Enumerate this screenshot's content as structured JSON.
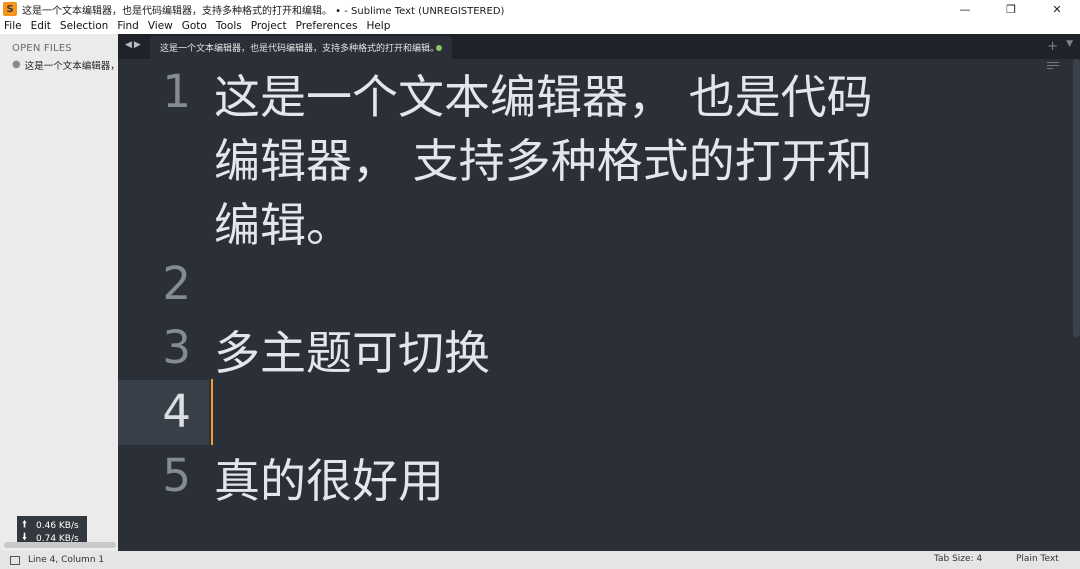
{
  "window": {
    "title": "这是一个文本编辑器，也是代码编辑器，支持多种格式的打开和编辑。 • - Sublime Text (UNREGISTERED)",
    "app_icon": "sublime-logo-icon",
    "controls": [
      "minimize-icon",
      "maximize-icon",
      "close-icon"
    ]
  },
  "menu": [
    "File",
    "Edit",
    "Selection",
    "Find",
    "View",
    "Goto",
    "Tools",
    "Project",
    "Preferences",
    "Help"
  ],
  "sidebar": {
    "heading": "OPEN FILES",
    "files": [
      {
        "name": "这是一个文本编辑器，"
      }
    ],
    "netmon": {
      "up": "0.46 KB/s",
      "down": "0.74 KB/s"
    }
  },
  "tabs": [
    {
      "title": "这是一个文本编辑器，也是代码编辑器，支持多种格式的打开和编辑。",
      "dirty": true
    }
  ],
  "editor": {
    "lines": [
      {
        "number": "1",
        "segments": [
          "这是一个文本编辑器， 也是代码",
          "编辑器， 支持多种格式的打开和",
          "编辑。"
        ]
      },
      {
        "number": "2",
        "segments": [
          ""
        ]
      },
      {
        "number": "3",
        "segments": [
          "多主题可切换"
        ]
      },
      {
        "number": "4",
        "segments": [
          ""
        ]
      },
      {
        "number": "5",
        "segments": [
          "真的很好用"
        ]
      }
    ],
    "active_line": 4
  },
  "status": {
    "position": "Line 4, Column 1",
    "tab_size": "Tab Size: 4",
    "syntax": "Plain Text"
  },
  "colors": {
    "editor_bg": "#2b2f37",
    "caret": "#f0a030",
    "dirty_dot": "#8fc466"
  }
}
